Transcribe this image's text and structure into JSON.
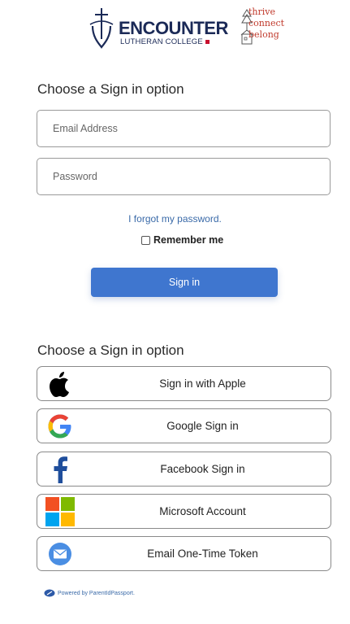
{
  "header": {
    "logo_title": "ENCOUNTER",
    "logo_subtitle": "LUTHERAN COLLEGE",
    "tagline": [
      "thrive",
      "connect",
      "belong"
    ]
  },
  "login": {
    "title": "Choose a Sign in option",
    "email_placeholder": "Email Address",
    "password_placeholder": "Password",
    "forgot_label": "I forgot my password.",
    "remember_label": "Remember me",
    "signin_label": "Sign in"
  },
  "providers": {
    "title": "Choose a Sign in option",
    "items": [
      {
        "label": "Sign in with Apple",
        "icon": "apple-icon"
      },
      {
        "label": "Google Sign in",
        "icon": "google-icon"
      },
      {
        "label": "Facebook Sign in",
        "icon": "facebook-icon"
      },
      {
        "label": "Microsoft Account",
        "icon": "microsoft-icon"
      },
      {
        "label": "Email One-Time Token",
        "icon": "email-icon"
      }
    ]
  },
  "footer": {
    "powered_by": "Powered by ParentIdPassport."
  },
  "colors": {
    "primary_button": "#3f76cf",
    "link": "#3a6aa8",
    "logo_navy": "#1b2a57",
    "tagline_red": "#c0392b"
  }
}
